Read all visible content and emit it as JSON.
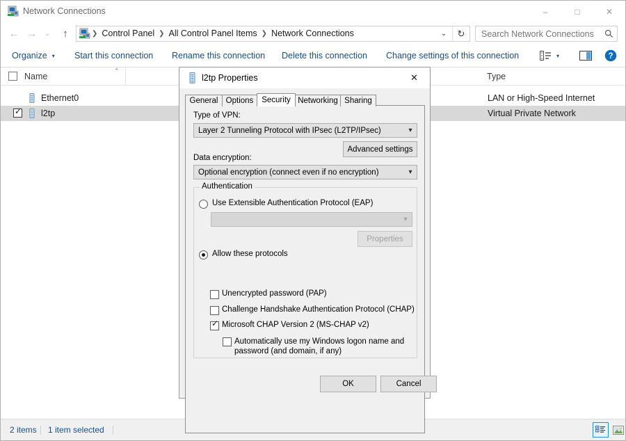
{
  "window": {
    "title": "Network Connections",
    "icon": "network-connections-icon",
    "controls": {
      "minimize": "–",
      "maximize": "□",
      "close": "✕"
    }
  },
  "nav": {
    "back": "←",
    "forward": "→",
    "recent": "⌄",
    "up": "↑",
    "breadcrumbs": [
      "Control Panel",
      "All Control Panel Items",
      "Network Connections"
    ],
    "separator": "❯",
    "dropdown": "⌄",
    "refresh": "↻"
  },
  "search": {
    "placeholder": "Search Network Connections",
    "icon": "search-icon"
  },
  "toolbar": {
    "organize": "Organize",
    "organize_caret": "▾",
    "items": [
      "Start this connection",
      "Rename this connection",
      "Delete this connection",
      "Change settings of this connection"
    ],
    "view_caret": "▾",
    "help": "?"
  },
  "columns": [
    {
      "label": "Name"
    },
    {
      "label": "Type"
    }
  ],
  "sort_caret": "⌃",
  "rows": [
    {
      "name": "Ethernet0",
      "type": "LAN or High-Speed Internet",
      "checked": false,
      "selected": false,
      "icon": "ethernet-adapter-icon"
    },
    {
      "name": "l2tp",
      "type": "Virtual Private Network",
      "checked": true,
      "selected": true,
      "icon": "vpn-adapter-icon"
    }
  ],
  "status": {
    "item_count": "2 items",
    "selection": "1 item selected",
    "view_details_icon": "details-view-icon",
    "view_large_icon": "large-icons-view-icon"
  },
  "dialog": {
    "title": "l2tp Properties",
    "icon": "vpn-adapter-icon",
    "close": "✕",
    "tabs": [
      {
        "label": "General",
        "active": false
      },
      {
        "label": "Options",
        "active": false
      },
      {
        "label": "Security",
        "active": true
      },
      {
        "label": "Networking",
        "active": false
      },
      {
        "label": "Sharing",
        "active": false
      }
    ],
    "vpn_type_label": "Type of VPN:",
    "vpn_type_value": "Layer 2 Tunneling Protocol with IPsec (L2TP/IPsec)",
    "advanced_settings_label": "Advanced settings",
    "data_encryption_label": "Data encryption:",
    "data_encryption_value": "Optional encryption (connect even if no encryption)",
    "authentication": {
      "group_title": "Authentication",
      "eap_radio_label": "Use Extensible Authentication Protocol (EAP)",
      "eap_radio_selected": false,
      "eap_combo_value": "",
      "eap_combo_disabled": true,
      "properties_button_label": "Properties",
      "properties_button_disabled": true,
      "allow_radio_label": "Allow these protocols",
      "allow_radio_selected": true,
      "protocols": [
        {
          "label": "Unencrypted password (PAP)",
          "checked": false
        },
        {
          "label": "Challenge Handshake Authentication Protocol (CHAP)",
          "checked": false
        },
        {
          "label": "Microsoft CHAP Version 2 (MS-CHAP v2)",
          "checked": true
        }
      ],
      "auto_logon_line1": "Automatically use my Windows logon name and",
      "auto_logon_line2": "password (and domain, if any)",
      "auto_logon_checked": false
    },
    "ok_label": "OK",
    "cancel_label": "Cancel"
  },
  "colors": {
    "accent": "#0078d7",
    "link": "#1a4d80",
    "selection": "#cce8ff",
    "selection_inactive": "#d8d8d8",
    "dialog_face": "#f0f0f0"
  }
}
